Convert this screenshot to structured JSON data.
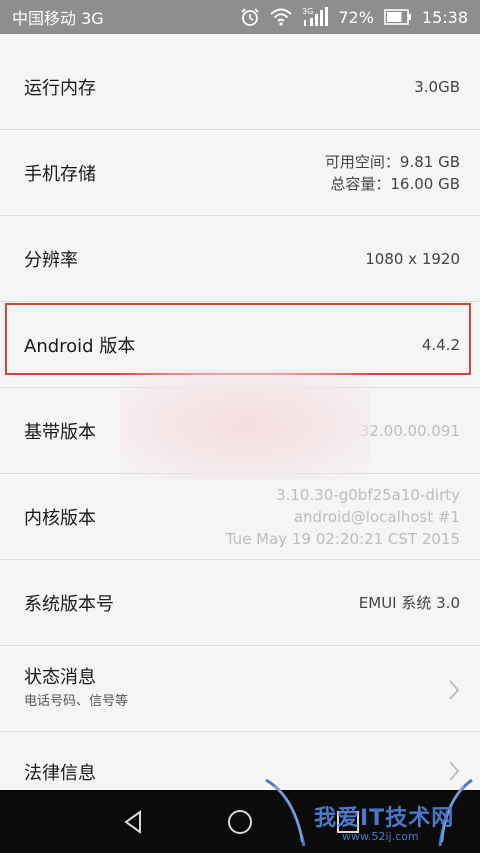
{
  "status_bar": {
    "carrier": "中国移动 3G",
    "network_type": "3G",
    "battery_percent": "72%",
    "time": "15:38",
    "icons": [
      "alarm-icon",
      "wifi-icon",
      "signal-icon",
      "battery-icon"
    ]
  },
  "rows": [
    {
      "label": "运行内存",
      "value": "3.0GB"
    },
    {
      "label": "手机存储",
      "value_lines": [
        "可用空间：9.81 GB",
        "总容量：16.00 GB"
      ]
    },
    {
      "label": "分辨率",
      "value": "1080 x 1920"
    },
    {
      "label": "Android 版本",
      "value": "4.4.2"
    },
    {
      "label": "基带版本",
      "value": "32.00.00.091"
    },
    {
      "label": "内核版本",
      "value_lines": [
        "3.10.30-g0bf25a10-dirty",
        "android@localhost #1",
        "Tue May 19 02:20:21 CST 2015"
      ]
    },
    {
      "label": "系统版本号",
      "value": "EMUI 系统 3.0"
    },
    {
      "label": "状态消息",
      "sublabel": "电话号码、信号等"
    },
    {
      "label": "法律信息"
    }
  ],
  "watermark": {
    "text": "我爱IT技术网",
    "url": "www.52ij.com"
  },
  "colors": {
    "status_bar": "#8e8e8e",
    "background": "#f5f5f5",
    "highlight": "#d4433f",
    "nav_bar": "#0b0b0b",
    "watermark": "#4b78c8"
  }
}
